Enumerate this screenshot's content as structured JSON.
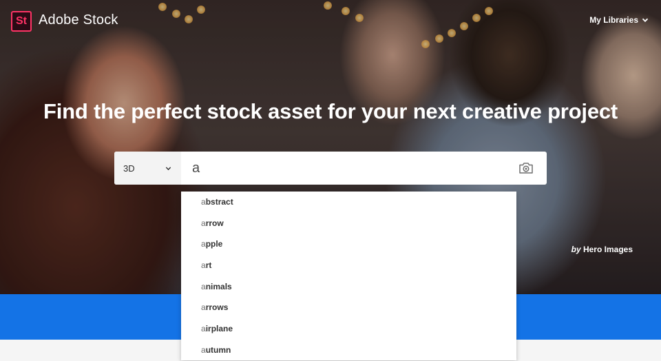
{
  "brand": {
    "badge": "St",
    "name": "Adobe Stock",
    "accent": "#ff3366"
  },
  "nav": {
    "my_libraries": "My Libraries"
  },
  "hero": {
    "headline": "Find the perfect stock asset for your next creative project",
    "credit_by": "by",
    "credit_name": "Hero Images"
  },
  "search": {
    "type_value": "3D",
    "query": "a",
    "camera_icon": "camera-icon"
  },
  "suggestions": [
    {
      "match": "a",
      "rest": "bstract"
    },
    {
      "match": "a",
      "rest": "rrow"
    },
    {
      "match": "a",
      "rest": "pple"
    },
    {
      "match": "a",
      "rest": "rt"
    },
    {
      "match": "a",
      "rest": "nimals"
    },
    {
      "match": "a",
      "rest": "rrows"
    },
    {
      "match": "a",
      "rest": "irplane"
    },
    {
      "match": "a",
      "rest": "utumn"
    }
  ],
  "colors": {
    "blue_band": "#1473e6",
    "background": "#f5f5f5"
  }
}
